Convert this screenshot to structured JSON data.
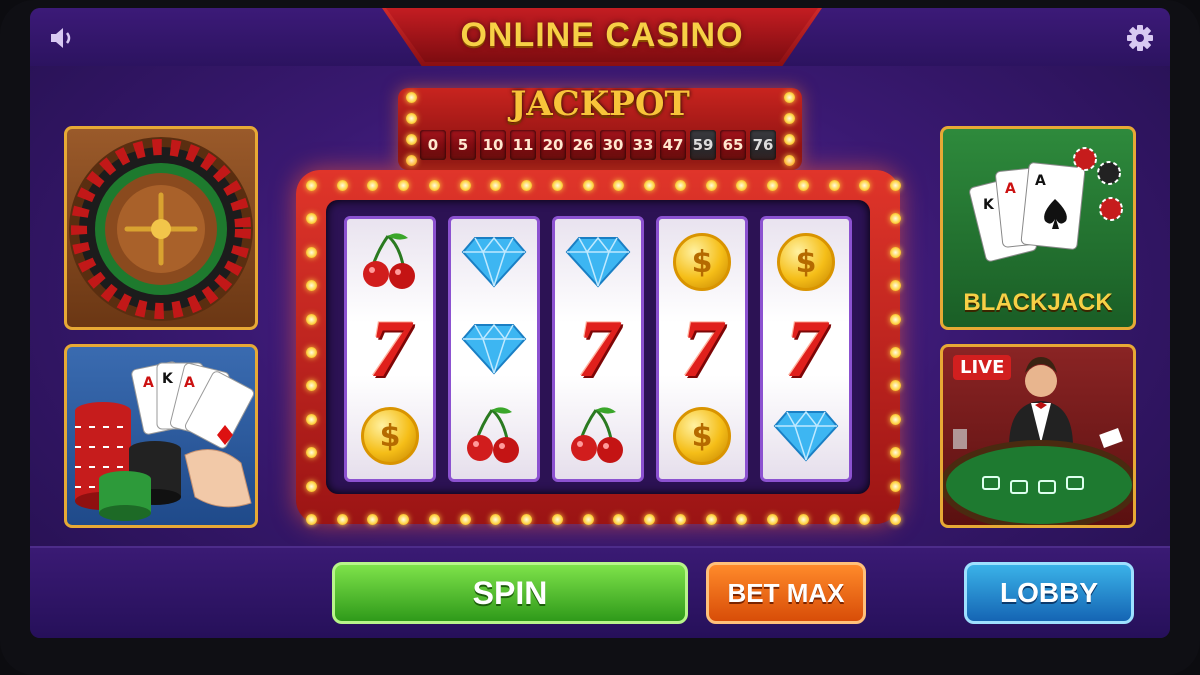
{
  "header": {
    "title": "ONLINE CASINO",
    "sound_icon": "speaker-icon",
    "settings_icon": "gear-icon"
  },
  "jackpot": {
    "title": "JACKPOT",
    "numbers": [
      "0",
      "5",
      "10",
      "11",
      "20",
      "26",
      "30",
      "33",
      "47",
      "59",
      "65",
      "76"
    ]
  },
  "slot": {
    "reels": [
      [
        "cherry",
        "seven",
        "coin"
      ],
      [
        "diamond",
        "diamond",
        "cherry"
      ],
      [
        "diamond",
        "seven",
        "cherry"
      ],
      [
        "coin",
        "seven",
        "coin"
      ],
      [
        "coin",
        "seven",
        "diamond"
      ]
    ],
    "seven_glyph": "7",
    "coin_glyph": "$"
  },
  "games": {
    "roulette": {
      "icon": "roulette-wheel-icon"
    },
    "poker": {
      "icon": "cards-and-chips-icon"
    },
    "blackjack": {
      "label": "BLACKJACK",
      "icon": "playing-cards-icon"
    },
    "live": {
      "badge": "LIVE",
      "icon": "live-dealer-icon"
    }
  },
  "controls": {
    "spin_label": "SPIN",
    "bet_max_label": "BET MAX",
    "lobby_label": "LOBBY"
  },
  "colors": {
    "background": "#3a1972",
    "gold": "#f7d046",
    "spin": "#2f9a1a",
    "bet_max": "#d84d08",
    "lobby": "#1565b4"
  }
}
